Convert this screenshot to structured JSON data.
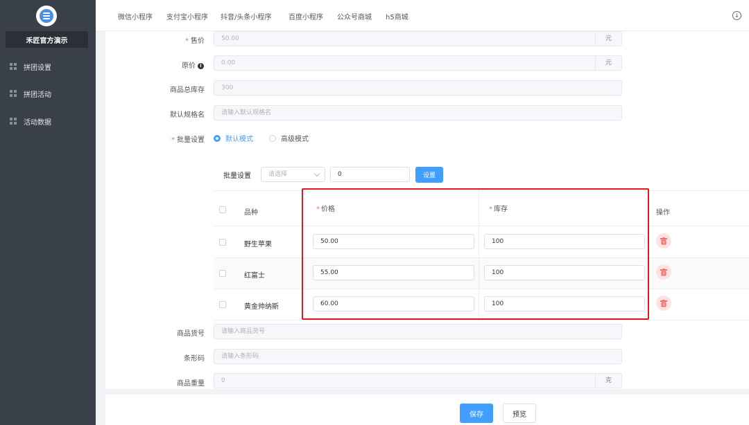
{
  "sidebar": {
    "brand": "禾匠官方演示",
    "items": [
      {
        "label": "拼团设置",
        "icon": "grid-icon"
      },
      {
        "label": "拼团活动",
        "icon": "grid-icon"
      },
      {
        "label": "活动数据",
        "icon": "grid-icon"
      }
    ]
  },
  "topnav": {
    "tabs": [
      "微信小程序",
      "支付宝小程序",
      "抖音/头条小程序",
      "百度小程序",
      "公众号商城",
      "h5商城"
    ],
    "download_icon": "download-circle-icon"
  },
  "form": {
    "price": {
      "label": "售价",
      "value": "50.00",
      "suffix": "元"
    },
    "original_price": {
      "label": "原价",
      "value": "0.00",
      "suffix": "元",
      "info": "i"
    },
    "total_stock": {
      "label": "商品总库存",
      "value": "300"
    },
    "default_spec": {
      "label": "默认规格名",
      "placeholder": "请输入默认规格名"
    },
    "batch_mode": {
      "label": "批量设置",
      "options": [
        "默认模式",
        "高级模式"
      ],
      "selected": "默认模式"
    },
    "goods_no": {
      "label": "商品货号",
      "placeholder": "请输入商品货号"
    },
    "barcode": {
      "label": "条形码",
      "placeholder": "请输入条形码"
    },
    "weight": {
      "label": "商品重量",
      "value": "0",
      "suffix": "克"
    }
  },
  "batch": {
    "label": "批量设置",
    "select_placeholder": "请选择",
    "value": "0",
    "button": "设置"
  },
  "spec_table": {
    "headers": {
      "variety": "品种",
      "price": "价格",
      "stock": "库存",
      "action": "操作"
    },
    "rows": [
      {
        "name": "野生苹果",
        "price": "50.00",
        "stock": "100"
      },
      {
        "name": "红富士",
        "price": "55.00",
        "stock": "100"
      },
      {
        "name": "黄金帅纳斯",
        "price": "60.00",
        "stock": "100"
      }
    ]
  },
  "footer": {
    "save": "保存",
    "preview": "预览"
  },
  "colors": {
    "primary": "#409eff",
    "sidebar": "#3a4049",
    "highlight": "#e5161b",
    "required": "#f56c6c"
  }
}
